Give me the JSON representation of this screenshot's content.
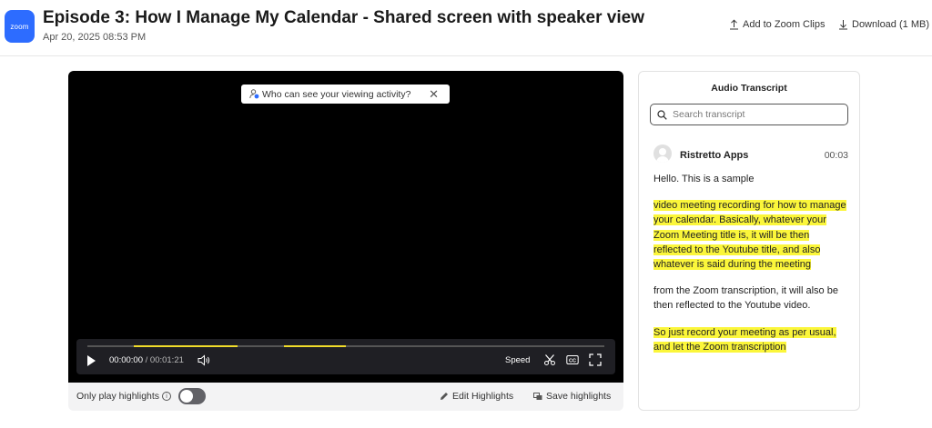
{
  "header": {
    "logo_text": "zoom",
    "title": "Episode 3: How I Manage My Calendar - Shared screen with speaker view",
    "date": "Apr 20, 2025 08:53 PM",
    "add_clips_label": "Add to Zoom Clips",
    "download_label": "Download (1 MB)"
  },
  "player": {
    "privacy_tip": "Who can see your viewing activity?",
    "current_time": "00:00:00",
    "separator": "/",
    "duration": "00:01:21",
    "speed_label": "Speed",
    "progress": 0,
    "highlight_segments": [
      {
        "start": 0.09,
        "end": 0.29
      },
      {
        "start": 0.38,
        "end": 0.5
      }
    ],
    "colors": {
      "highlight": "#f0dc2a",
      "accent": "#2d6cff"
    }
  },
  "below_player": {
    "only_play_highlights_label": "Only play highlights",
    "only_play_highlights_on": false,
    "edit_highlights_label": "Edit Highlights",
    "save_highlights_label": "Save highlights"
  },
  "transcript": {
    "title": "Audio Transcript",
    "search_placeholder": "Search transcript",
    "speaker": "Ristretto Apps",
    "timestamp": "00:03",
    "segments": [
      {
        "text": "Hello. This is a sample",
        "highlighted": false
      },
      {
        "text": "video meeting recording for how to manage your calendar. Basically, whatever your Zoom Meeting title is, it will be then reflected to the Youtube title, and also whatever is said during the meeting",
        "highlighted": true
      },
      {
        "text": "from the Zoom transcription, it will also be then reflected to the Youtube video.",
        "highlighted": false
      },
      {
        "text": "So just record your meeting as per usual, and let the Zoom transcription",
        "highlighted": true
      }
    ]
  }
}
